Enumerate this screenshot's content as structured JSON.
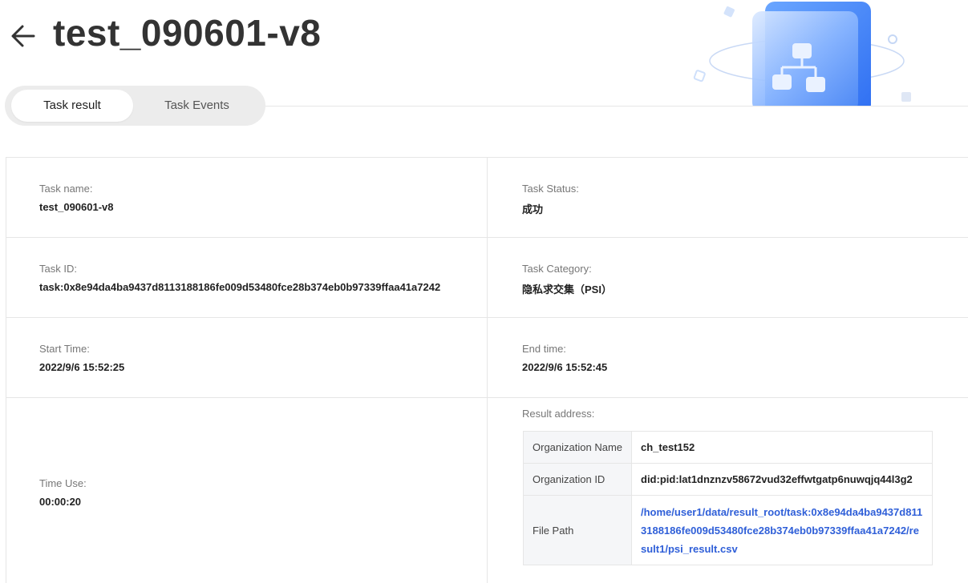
{
  "header": {
    "title": "test_090601-v8",
    "back_icon": "arrow-left-icon"
  },
  "tabs": [
    {
      "label": "Task result",
      "active": true
    },
    {
      "label": "Task Events",
      "active": false
    }
  ],
  "task": {
    "name_label": "Task name:",
    "name": "test_090601-v8",
    "status_label": "Task Status:",
    "status": "成功",
    "id_label": "Task ID:",
    "id": "task:0x8e94da4ba9437d8113188186fe009d53480fce28b374eb0b97339ffaa41a7242",
    "category_label": "Task Category:",
    "category": "隐私求交集（PSI）",
    "start_label": "Start Time:",
    "start": "2022/9/6 15:52:25",
    "end_label": "End time:",
    "end": "2022/9/6 15:52:45",
    "timeuse_label": "Time Use:",
    "timeuse": "00:00:20",
    "result_label": "Result address:"
  },
  "result": {
    "org_name_label": "Organization Name",
    "org_name": "ch_test152",
    "org_id_label": "Organization ID",
    "org_id": "did:pid:lat1dnznzv58672vud32effwtgatp6nuwqjq44l3g2",
    "file_path_label": "File Path",
    "file_path": "/home/user1/data/result_root/task:0x8e94da4ba9437d8113188186fe009d53480fce28b374eb0b97339ffaa41a7242/result1/psi_result.csv"
  },
  "colors": {
    "link": "#2f5fd8",
    "accent_blue": "#3f7cf5"
  }
}
